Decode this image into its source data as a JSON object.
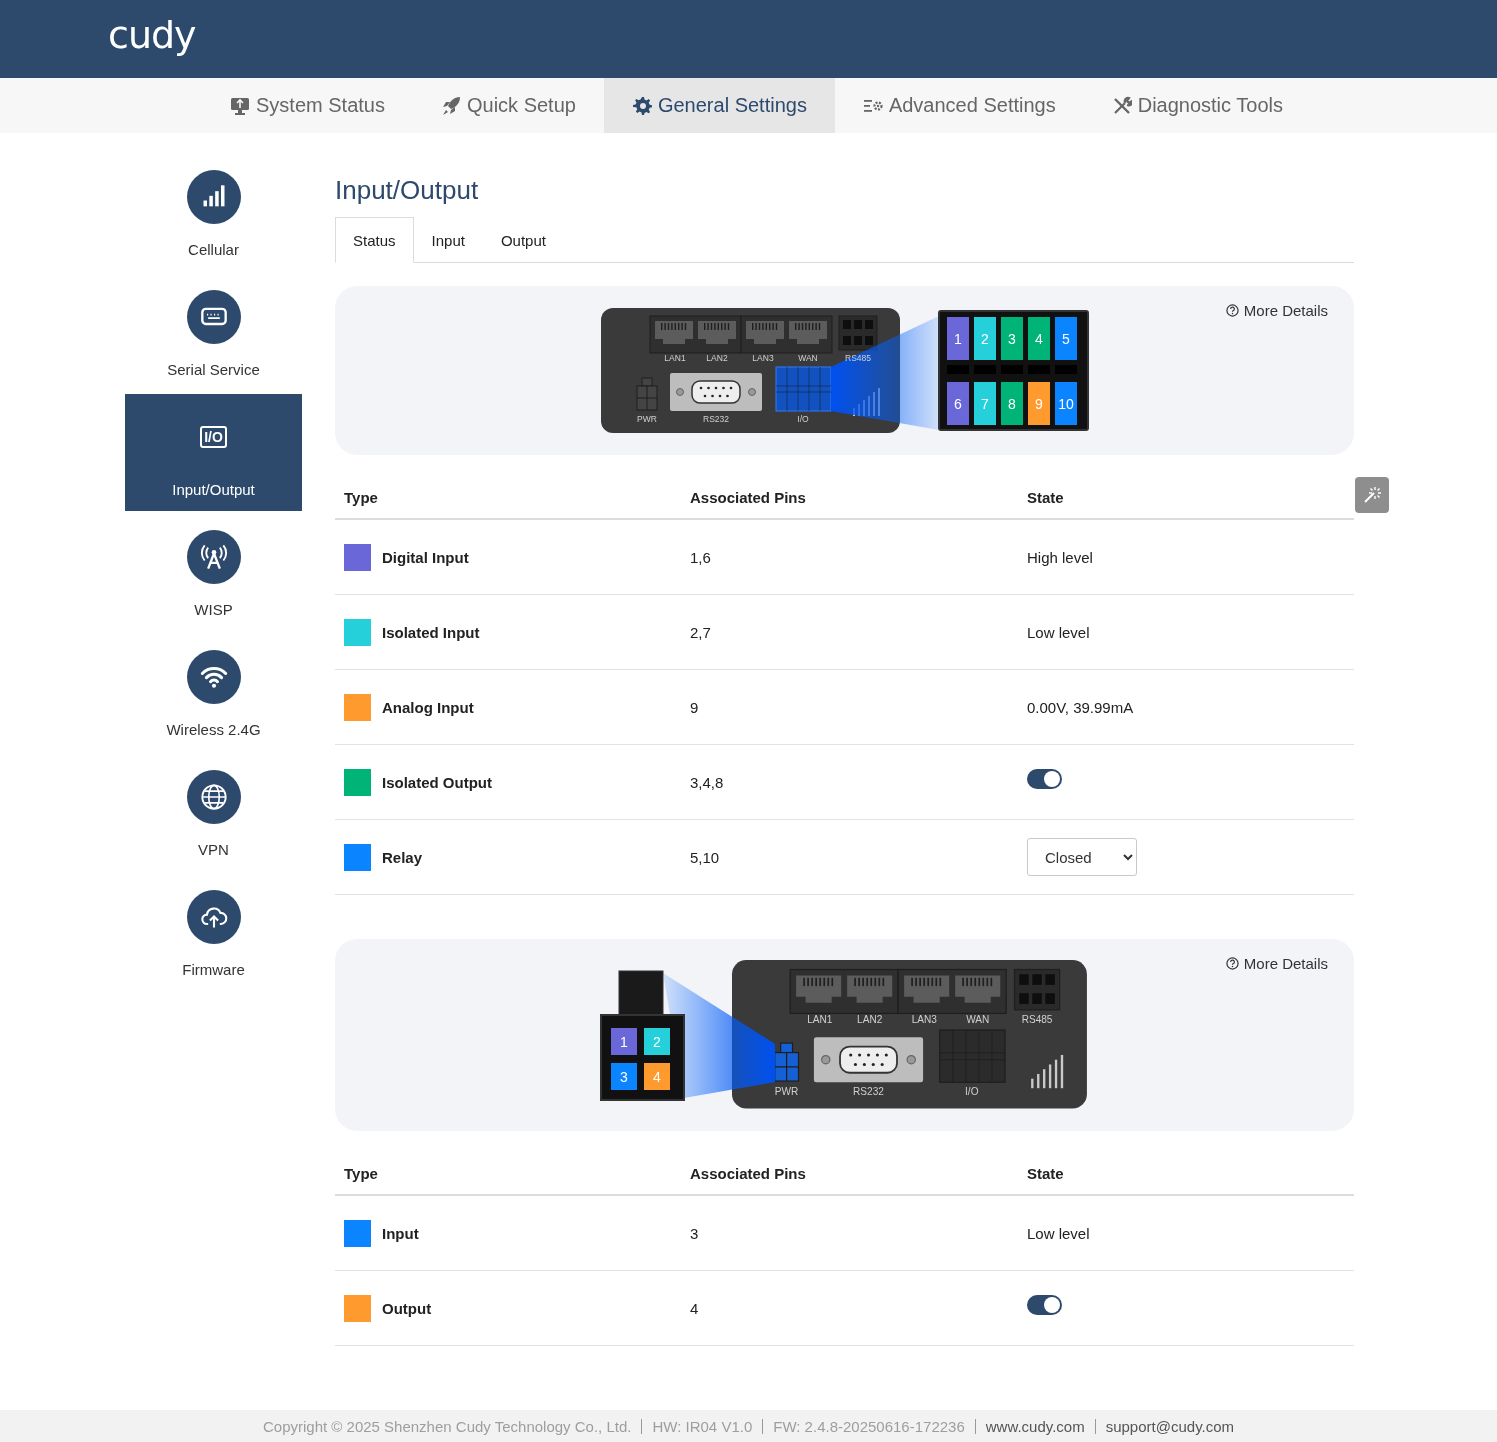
{
  "header": {
    "logo": "cudy"
  },
  "nav": [
    {
      "label": "System Status",
      "selected": false
    },
    {
      "label": "Quick Setup",
      "selected": false
    },
    {
      "label": "General Settings",
      "selected": true
    },
    {
      "label": "Advanced Settings",
      "selected": false
    },
    {
      "label": "Diagnostic Tools",
      "selected": false
    }
  ],
  "sidebar": [
    {
      "label": "Cellular",
      "selected": false
    },
    {
      "label": "Serial Service",
      "selected": false
    },
    {
      "label": "Input/Output",
      "selected": true,
      "icon_text": "I/O"
    },
    {
      "label": "WISP",
      "selected": false
    },
    {
      "label": "Wireless 2.4G",
      "selected": false
    },
    {
      "label": "VPN",
      "selected": false
    },
    {
      "label": "Firmware",
      "selected": false
    }
  ],
  "page": {
    "title": "Input/Output",
    "tabs": [
      {
        "label": "Status",
        "selected": true
      },
      {
        "label": "Input",
        "selected": false
      },
      {
        "label": "Output",
        "selected": false
      }
    ]
  },
  "sections": [
    {
      "more_details": "More Details",
      "diagram": {
        "kind": "terminal_block",
        "device_labels": [
          "LAN1",
          "LAN2",
          "LAN3",
          "WAN",
          "RS485",
          "PWR",
          "RS232",
          "I/O"
        ],
        "pins": [
          {
            "number": "1",
            "color": "#6a67d8"
          },
          {
            "number": "2",
            "color": "#26d0da"
          },
          {
            "number": "3",
            "color": "#00b377"
          },
          {
            "number": "4",
            "color": "#00b377"
          },
          {
            "number": "5",
            "color": "#0a84ff"
          },
          {
            "number": "6",
            "color": "#6a67d8"
          },
          {
            "number": "7",
            "color": "#26d0da"
          },
          {
            "number": "8",
            "color": "#00b377"
          },
          {
            "number": "9",
            "color": "#ff9a2e"
          },
          {
            "number": "10",
            "color": "#0a84ff"
          }
        ]
      },
      "columns": [
        "Type",
        "Associated Pins",
        "State"
      ],
      "tool_button": true,
      "rows": [
        {
          "type": "Digital Input",
          "color": "#6a67d8",
          "pins": "1,6",
          "state": {
            "kind": "text",
            "text": "High level"
          }
        },
        {
          "type": "Isolated Input",
          "color": "#26d0da",
          "pins": "2,7",
          "state": {
            "kind": "text",
            "text": "Low level"
          }
        },
        {
          "type": "Analog Input",
          "color": "#ff9a2e",
          "pins": "9",
          "state": {
            "kind": "text",
            "text": "0.00V, 39.99mA"
          }
        },
        {
          "type": "Isolated Output",
          "color": "#00b377",
          "pins": "3,4,8",
          "state": {
            "kind": "toggle",
            "on": true
          }
        },
        {
          "type": "Relay",
          "color": "#0a84ff",
          "pins": "5,10",
          "state": {
            "kind": "select",
            "value": "Closed"
          }
        }
      ]
    },
    {
      "more_details": "More Details",
      "diagram": {
        "kind": "power_connector",
        "device_labels": [
          "LAN1",
          "LAN2",
          "LAN3",
          "WAN",
          "RS485",
          "PWR",
          "RS232",
          "I/O"
        ],
        "pins": [
          {
            "number": "1",
            "color": "#6a67d8"
          },
          {
            "number": "2",
            "color": "#26d0da"
          },
          {
            "number": "3",
            "color": "#0a84ff"
          },
          {
            "number": "4",
            "color": "#ff9a2e"
          }
        ]
      },
      "columns": [
        "Type",
        "Associated Pins",
        "State"
      ],
      "rows": [
        {
          "type": "Input",
          "color": "#0a84ff",
          "pins": "3",
          "state": {
            "kind": "text",
            "text": "Low level"
          }
        },
        {
          "type": "Output",
          "color": "#ff9a2e",
          "pins": "4",
          "state": {
            "kind": "toggle",
            "on": true
          }
        }
      ]
    }
  ],
  "footer": [
    {
      "kind": "text",
      "text": "Copyright © 2025 Shenzhen Cudy Technology Co., Ltd."
    },
    {
      "kind": "text",
      "text": "HW: IR04 V1.0"
    },
    {
      "kind": "text",
      "text": "FW: 2.4.8-20250616-172236"
    },
    {
      "kind": "link",
      "text": "www.cudy.com"
    },
    {
      "kind": "link",
      "text": "support@cudy.com"
    }
  ]
}
